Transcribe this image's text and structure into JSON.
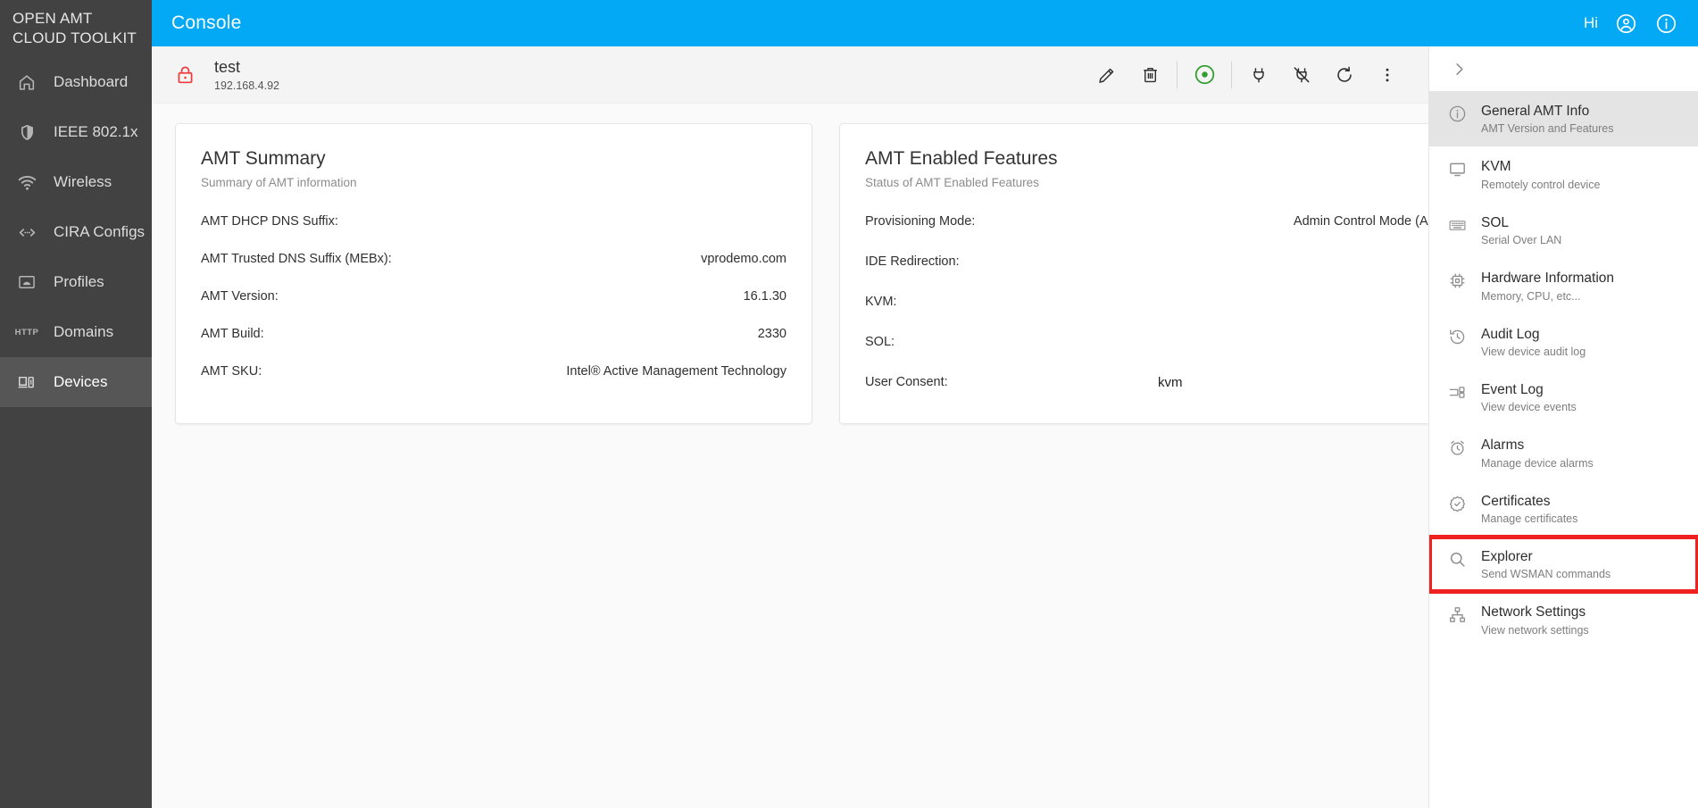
{
  "brand": {
    "line1": "OPEN AMT",
    "line2": "CLOUD TOOLKIT"
  },
  "sidebar": {
    "items": [
      {
        "label": "Dashboard",
        "icon": "home-icon",
        "active": false
      },
      {
        "label": "IEEE 802.1x",
        "icon": "shield-icon",
        "active": false
      },
      {
        "label": "Wireless",
        "icon": "wifi-icon",
        "active": false
      },
      {
        "label": "CIRA Configs",
        "icon": "code-icon",
        "active": false
      },
      {
        "label": "Profiles",
        "icon": "profile-icon",
        "active": false
      },
      {
        "label": "Domains",
        "icon": "http-icon",
        "active": false
      },
      {
        "label": "Devices",
        "icon": "devices-icon",
        "active": true
      }
    ]
  },
  "topbar": {
    "title": "Console",
    "hi": "Hi",
    "account_icon": "account-circle-icon",
    "info_icon": "info-circle-icon",
    "accent_color": "#03a9f4"
  },
  "device": {
    "lock_icon": "lock-icon",
    "lock_color": "#ef3b3b",
    "name": "test",
    "ip": "192.168.4.92",
    "actions": [
      {
        "name": "edit-device-button",
        "icon": "pencil-icon"
      },
      {
        "name": "delete-device-button",
        "icon": "trash-icon"
      },
      {
        "name": "power-state-indicator",
        "icon": "power-dot-icon",
        "color": "#2e9e2e"
      },
      {
        "name": "power-on-button",
        "icon": "plug-icon"
      },
      {
        "name": "power-off-button",
        "icon": "plug-off-icon"
      },
      {
        "name": "reset-button",
        "icon": "refresh-icon"
      },
      {
        "name": "more-options-button",
        "icon": "more-vertical-icon"
      }
    ]
  },
  "summary_card": {
    "title": "AMT Summary",
    "subtitle": "Summary of AMT information",
    "rows": [
      {
        "label": "AMT DHCP DNS Suffix:",
        "value": ""
      },
      {
        "label": "AMT Trusted DNS Suffix (MEBx):",
        "value": "vprodemo.com"
      },
      {
        "label": "AMT Version:",
        "value": "16.1.30"
      },
      {
        "label": "AMT Build:",
        "value": "2330"
      },
      {
        "label": "AMT SKU:",
        "value": "Intel® Active Management Technology"
      }
    ]
  },
  "features_card": {
    "title": "AMT Enabled Features",
    "subtitle": "Status of AMT Enabled Features",
    "provisioning_label": "Provisioning Mode:",
    "provisioning_value": "Admin Control Mode (ACM)",
    "ide_label": "IDE Redirection:",
    "ide_checked": true,
    "kvm_label": "KVM:",
    "kvm_checked": false,
    "sol_label": "SOL:",
    "sol_checked": true,
    "consent_label": "User Consent:",
    "consent_value": "kvm"
  },
  "right_panel": {
    "expand_icon": "chevron-right-icon",
    "items": [
      {
        "title": "General AMT Info",
        "sub": "AMT Version and Features",
        "icon": "info-circle-icon",
        "state": "selected"
      },
      {
        "title": "KVM",
        "sub": "Remotely control device",
        "icon": "monitor-icon",
        "state": "normal"
      },
      {
        "title": "SOL",
        "sub": "Serial Over LAN",
        "icon": "keyboard-icon",
        "state": "normal"
      },
      {
        "title": "Hardware Information",
        "sub": "Memory, CPU, etc...",
        "icon": "cpu-icon",
        "state": "normal"
      },
      {
        "title": "Audit Log",
        "sub": "View device audit log",
        "icon": "history-icon",
        "state": "normal"
      },
      {
        "title": "Event Log",
        "sub": "View device events",
        "icon": "list-icon",
        "state": "normal"
      },
      {
        "title": "Alarms",
        "sub": "Manage device alarms",
        "icon": "alarm-icon",
        "state": "normal"
      },
      {
        "title": "Certificates",
        "sub": "Manage certificates",
        "icon": "certificate-icon",
        "state": "normal"
      },
      {
        "title": "Explorer",
        "sub": "Send WSMAN commands",
        "icon": "search-icon",
        "state": "highlight"
      },
      {
        "title": "Network Settings",
        "sub": "View network settings",
        "icon": "network-icon",
        "state": "normal"
      }
    ],
    "highlight_color": "#ef2020"
  }
}
